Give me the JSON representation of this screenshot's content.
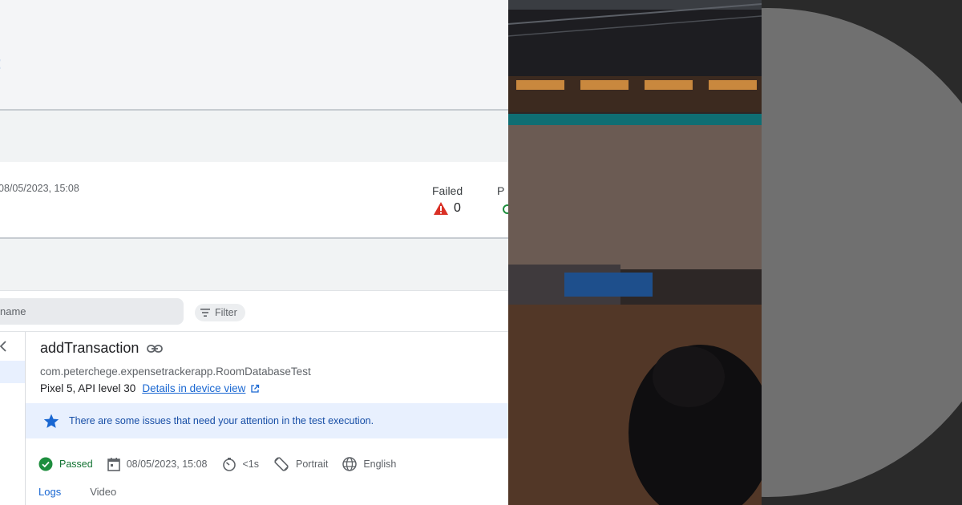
{
  "run": {
    "date": "08/05/2023, 15:08",
    "failed_label": "Failed",
    "failed_count": "0",
    "passed_label_partial": "P"
  },
  "filterbar": {
    "search_placeholder": "name",
    "filter_label": "Filter"
  },
  "detail": {
    "title": "addTransaction",
    "class_name": "com.peterchege.expensetrackerapp.RoomDatabaseTest",
    "device": "Pixel 5, API level 30",
    "device_link": "Details in device view",
    "alert": "There are some issues that need your attention in the test execution.",
    "status": "Passed",
    "date": "08/05/2023, 15:08",
    "duration": "<1s",
    "orientation": "Portrait",
    "locale": "English",
    "tabs": [
      {
        "label": "Logs",
        "active": true
      },
      {
        "label": "Video",
        "active": false
      }
    ]
  },
  "colors": {
    "accent": "#1967d2",
    "passed": "#1e8e3e",
    "failed": "#d93025",
    "alert_bg": "#e8f0fe"
  },
  "icons": [
    "warning-icon",
    "filter-icon",
    "back-chevron-icon",
    "link-icon",
    "external-link-icon",
    "star-icon",
    "check-circle-icon",
    "calendar-icon",
    "timer-icon",
    "rotate-icon",
    "globe-icon"
  ]
}
